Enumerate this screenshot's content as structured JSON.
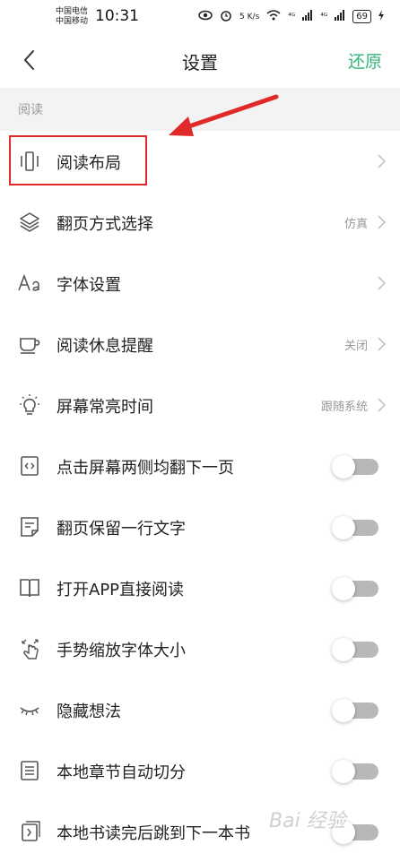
{
  "status_bar": {
    "carrier_1": "中国电信",
    "carrier_2": "中国移动",
    "time": "10:31",
    "net_speed": "5 K/s",
    "signal_1": "⁴ᴳ",
    "signal_2": "⁴ᴳ",
    "battery": "69"
  },
  "header": {
    "title": "设置",
    "restore_label": "还原",
    "back_icon": "chevron-left-icon"
  },
  "section": {
    "title": "阅读"
  },
  "items": [
    {
      "label": "阅读布局",
      "icon": "layout-icon",
      "type": "nav",
      "value": ""
    },
    {
      "label": "翻页方式选择",
      "icon": "layers-icon",
      "type": "nav",
      "value": "仿真"
    },
    {
      "label": "字体设置",
      "icon": "font-icon",
      "type": "nav",
      "value": ""
    },
    {
      "label": "阅读休息提醒",
      "icon": "cup-icon",
      "type": "nav",
      "value": "关闭"
    },
    {
      "label": "屏幕常亮时间",
      "icon": "bulb-icon",
      "type": "nav",
      "value": "跟随系统"
    },
    {
      "label": "点击屏幕两侧均翻下一页",
      "icon": "tap-sides-icon",
      "type": "toggle",
      "on": false
    },
    {
      "label": "翻页保留一行文字",
      "icon": "note-icon",
      "type": "toggle",
      "on": false
    },
    {
      "label": "打开APP直接阅读",
      "icon": "book-icon",
      "type": "toggle",
      "on": false
    },
    {
      "label": "手势缩放字体大小",
      "icon": "gesture-icon",
      "type": "toggle",
      "on": false
    },
    {
      "label": "隐藏想法",
      "icon": "eye-closed-icon",
      "type": "toggle",
      "on": false
    },
    {
      "label": "本地章节自动切分",
      "icon": "list-icon",
      "type": "toggle",
      "on": false
    },
    {
      "label": "本地书读完后跳到下一本书",
      "icon": "next-book-icon",
      "type": "toggle",
      "on": false
    }
  ],
  "colors": {
    "accent": "#34b57a",
    "annotation": "#e02a2a",
    "toggle_off": "#b8b8b8"
  },
  "watermark": "Bai 经验"
}
